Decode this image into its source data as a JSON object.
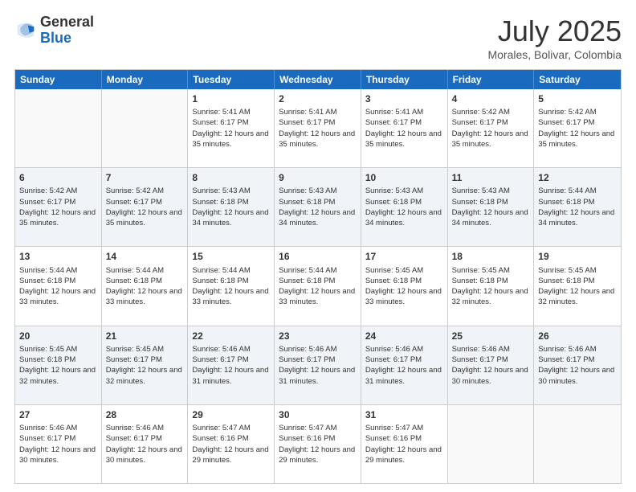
{
  "header": {
    "logo_general": "General",
    "logo_blue": "Blue",
    "month_title": "July 2025",
    "subtitle": "Morales, Bolivar, Colombia"
  },
  "calendar": {
    "days_of_week": [
      "Sunday",
      "Monday",
      "Tuesday",
      "Wednesday",
      "Thursday",
      "Friday",
      "Saturday"
    ],
    "weeks": [
      [
        {
          "day": "",
          "empty": true
        },
        {
          "day": "",
          "empty": true
        },
        {
          "day": "1",
          "sunrise": "Sunrise: 5:41 AM",
          "sunset": "Sunset: 6:17 PM",
          "daylight": "Daylight: 12 hours and 35 minutes."
        },
        {
          "day": "2",
          "sunrise": "Sunrise: 5:41 AM",
          "sunset": "Sunset: 6:17 PM",
          "daylight": "Daylight: 12 hours and 35 minutes."
        },
        {
          "day": "3",
          "sunrise": "Sunrise: 5:41 AM",
          "sunset": "Sunset: 6:17 PM",
          "daylight": "Daylight: 12 hours and 35 minutes."
        },
        {
          "day": "4",
          "sunrise": "Sunrise: 5:42 AM",
          "sunset": "Sunset: 6:17 PM",
          "daylight": "Daylight: 12 hours and 35 minutes."
        },
        {
          "day": "5",
          "sunrise": "Sunrise: 5:42 AM",
          "sunset": "Sunset: 6:17 PM",
          "daylight": "Daylight: 12 hours and 35 minutes."
        }
      ],
      [
        {
          "day": "6",
          "sunrise": "Sunrise: 5:42 AM",
          "sunset": "Sunset: 6:17 PM",
          "daylight": "Daylight: 12 hours and 35 minutes."
        },
        {
          "day": "7",
          "sunrise": "Sunrise: 5:42 AM",
          "sunset": "Sunset: 6:17 PM",
          "daylight": "Daylight: 12 hours and 35 minutes."
        },
        {
          "day": "8",
          "sunrise": "Sunrise: 5:43 AM",
          "sunset": "Sunset: 6:18 PM",
          "daylight": "Daylight: 12 hours and 34 minutes."
        },
        {
          "day": "9",
          "sunrise": "Sunrise: 5:43 AM",
          "sunset": "Sunset: 6:18 PM",
          "daylight": "Daylight: 12 hours and 34 minutes."
        },
        {
          "day": "10",
          "sunrise": "Sunrise: 5:43 AM",
          "sunset": "Sunset: 6:18 PM",
          "daylight": "Daylight: 12 hours and 34 minutes."
        },
        {
          "day": "11",
          "sunrise": "Sunrise: 5:43 AM",
          "sunset": "Sunset: 6:18 PM",
          "daylight": "Daylight: 12 hours and 34 minutes."
        },
        {
          "day": "12",
          "sunrise": "Sunrise: 5:44 AM",
          "sunset": "Sunset: 6:18 PM",
          "daylight": "Daylight: 12 hours and 34 minutes."
        }
      ],
      [
        {
          "day": "13",
          "sunrise": "Sunrise: 5:44 AM",
          "sunset": "Sunset: 6:18 PM",
          "daylight": "Daylight: 12 hours and 33 minutes."
        },
        {
          "day": "14",
          "sunrise": "Sunrise: 5:44 AM",
          "sunset": "Sunset: 6:18 PM",
          "daylight": "Daylight: 12 hours and 33 minutes."
        },
        {
          "day": "15",
          "sunrise": "Sunrise: 5:44 AM",
          "sunset": "Sunset: 6:18 PM",
          "daylight": "Daylight: 12 hours and 33 minutes."
        },
        {
          "day": "16",
          "sunrise": "Sunrise: 5:44 AM",
          "sunset": "Sunset: 6:18 PM",
          "daylight": "Daylight: 12 hours and 33 minutes."
        },
        {
          "day": "17",
          "sunrise": "Sunrise: 5:45 AM",
          "sunset": "Sunset: 6:18 PM",
          "daylight": "Daylight: 12 hours and 33 minutes."
        },
        {
          "day": "18",
          "sunrise": "Sunrise: 5:45 AM",
          "sunset": "Sunset: 6:18 PM",
          "daylight": "Daylight: 12 hours and 32 minutes."
        },
        {
          "day": "19",
          "sunrise": "Sunrise: 5:45 AM",
          "sunset": "Sunset: 6:18 PM",
          "daylight": "Daylight: 12 hours and 32 minutes."
        }
      ],
      [
        {
          "day": "20",
          "sunrise": "Sunrise: 5:45 AM",
          "sunset": "Sunset: 6:18 PM",
          "daylight": "Daylight: 12 hours and 32 minutes."
        },
        {
          "day": "21",
          "sunrise": "Sunrise: 5:45 AM",
          "sunset": "Sunset: 6:17 PM",
          "daylight": "Daylight: 12 hours and 32 minutes."
        },
        {
          "day": "22",
          "sunrise": "Sunrise: 5:46 AM",
          "sunset": "Sunset: 6:17 PM",
          "daylight": "Daylight: 12 hours and 31 minutes."
        },
        {
          "day": "23",
          "sunrise": "Sunrise: 5:46 AM",
          "sunset": "Sunset: 6:17 PM",
          "daylight": "Daylight: 12 hours and 31 minutes."
        },
        {
          "day": "24",
          "sunrise": "Sunrise: 5:46 AM",
          "sunset": "Sunset: 6:17 PM",
          "daylight": "Daylight: 12 hours and 31 minutes."
        },
        {
          "day": "25",
          "sunrise": "Sunrise: 5:46 AM",
          "sunset": "Sunset: 6:17 PM",
          "daylight": "Daylight: 12 hours and 30 minutes."
        },
        {
          "day": "26",
          "sunrise": "Sunrise: 5:46 AM",
          "sunset": "Sunset: 6:17 PM",
          "daylight": "Daylight: 12 hours and 30 minutes."
        }
      ],
      [
        {
          "day": "27",
          "sunrise": "Sunrise: 5:46 AM",
          "sunset": "Sunset: 6:17 PM",
          "daylight": "Daylight: 12 hours and 30 minutes."
        },
        {
          "day": "28",
          "sunrise": "Sunrise: 5:46 AM",
          "sunset": "Sunset: 6:17 PM",
          "daylight": "Daylight: 12 hours and 30 minutes."
        },
        {
          "day": "29",
          "sunrise": "Sunrise: 5:47 AM",
          "sunset": "Sunset: 6:16 PM",
          "daylight": "Daylight: 12 hours and 29 minutes."
        },
        {
          "day": "30",
          "sunrise": "Sunrise: 5:47 AM",
          "sunset": "Sunset: 6:16 PM",
          "daylight": "Daylight: 12 hours and 29 minutes."
        },
        {
          "day": "31",
          "sunrise": "Sunrise: 5:47 AM",
          "sunset": "Sunset: 6:16 PM",
          "daylight": "Daylight: 12 hours and 29 minutes."
        },
        {
          "day": "",
          "empty": true
        },
        {
          "day": "",
          "empty": true
        }
      ]
    ]
  }
}
